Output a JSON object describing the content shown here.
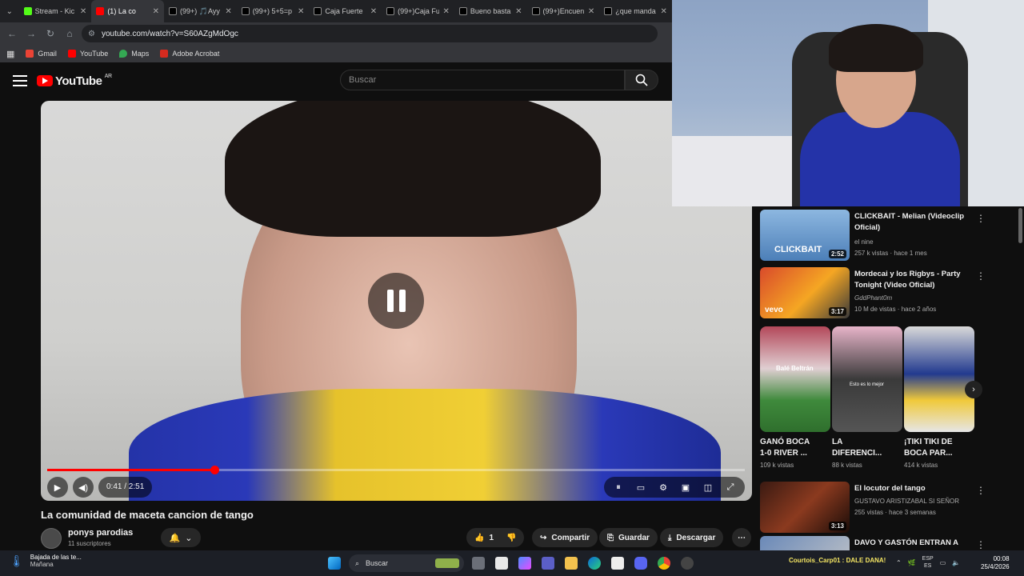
{
  "browser": {
    "tabs": [
      {
        "label": "Stream - Kic",
        "color": "#53fc18"
      },
      {
        "label": "(1) La co",
        "color": "#ff0000"
      },
      {
        "label": "(99+) 🎵Ayy",
        "color": "#000000"
      },
      {
        "label": "(99+) 5+5=p",
        "color": "#000000"
      },
      {
        "label": "Caja Fuerte",
        "color": "#000000"
      },
      {
        "label": "(99+)Caja Fu",
        "color": "#000000"
      },
      {
        "label": "Bueno basta",
        "color": "#000000"
      },
      {
        "label": "(99+)Encuen",
        "color": "#000000"
      },
      {
        "label": "¿que manda",
        "color": "#000000"
      }
    ],
    "url": "youtube.com/watch?v=S60AZgMdOgc",
    "bookmarks": [
      "Gmail",
      "YouTube",
      "Maps",
      "Adobe Acrobat"
    ]
  },
  "youtube": {
    "logo_text": "YouTube",
    "country": "AR",
    "search_placeholder": "Buscar"
  },
  "player": {
    "time": "0:41 / 2:51",
    "progress_fraction": 0.24
  },
  "video": {
    "title": "La comunidad de maceta cancion de tango",
    "channel": "ponys parodias",
    "subscribers": "11 suscriptores",
    "likes": "1",
    "share_label": "Compartir",
    "save_label": "Guardar",
    "download_label": "Descargar"
  },
  "related": [
    {
      "title": "CLICKBAIT - Melian (Videoclip Oficial)",
      "channel": "el nine",
      "meta": "257 k vistas · hace 1 mes",
      "duration": "2:52",
      "thumb_text": "CLICKBAIT"
    },
    {
      "title": "Mordecai y los Rigbys - Party Tonight (Video Oficial)",
      "channel": "GddPhant0m",
      "meta": "10 M de vistas · hace 2 años",
      "duration": "3:17",
      "thumb_text": "vevo"
    },
    {
      "title": "El locutor del tango",
      "channel": "GUSTAVO ARISTIZABAL SI SEÑOR",
      "meta": "255 vistas · hace 3 semanas",
      "duration": "3:13"
    },
    {
      "title": "DAVO Y GASTÓN ENTRAN A",
      "channel": "",
      "meta": "",
      "duration": ""
    }
  ],
  "shorts": [
    {
      "title": "GANÓ BOCA 1-0 RIVER ...",
      "views": "109 k vistas",
      "overlay": "Balé Beltrán"
    },
    {
      "title": "LA DIFERENCI...",
      "views": "88 k vistas",
      "overlay": "Esto es lo mejor"
    },
    {
      "title": "¡TIKI TIKI DE BOCA PAR...",
      "views": "414 k vistas",
      "overlay": ""
    }
  ],
  "taskbar": {
    "weather_line1": "Bajada de las te...",
    "weather_line2": "Mañana",
    "search": "Buscar",
    "notification": "Courtois_Carp01 : DALE DANA!",
    "lang_top": "ESP",
    "lang_bottom": "ES",
    "time": "00:08",
    "date": "25/4/2026"
  }
}
